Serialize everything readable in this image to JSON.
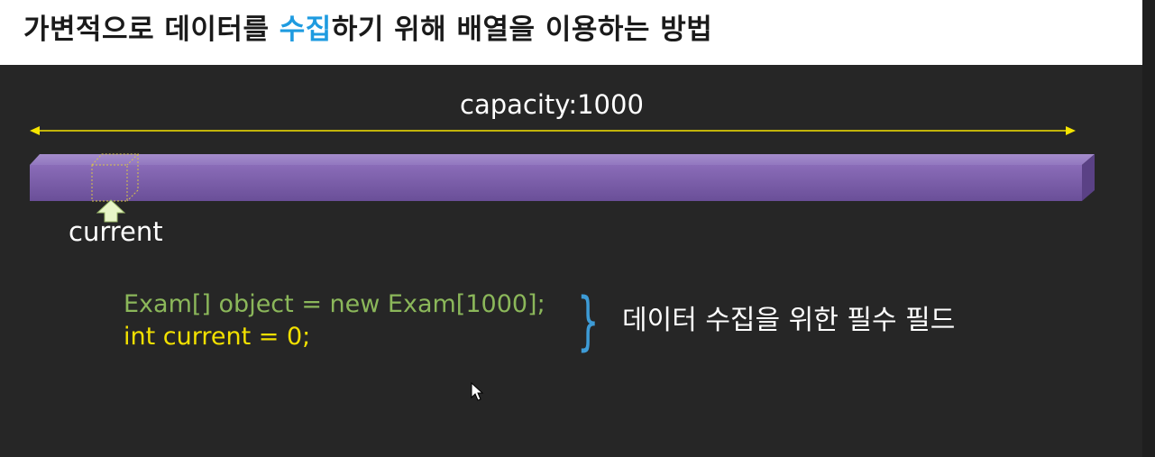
{
  "title": {
    "before": "가변적으로 데이터를 ",
    "highlight": "수집",
    "after": "하기 위해 배열을 이용하는 방법"
  },
  "diagram": {
    "capacity_label": "capacity:1000",
    "current_label": "current",
    "colors": {
      "array_bar": "#7b5ea7",
      "arrow_line": "#f5e400",
      "pointer_arrow": "#e8f5c8",
      "slot_outline": "#d8c44a"
    }
  },
  "code": {
    "line1": "Exam[] object = new Exam[1000];",
    "line2": "int current = 0;"
  },
  "annotation": {
    "brace": "}",
    "label": "데이터 수집을 위한 필수 필드"
  }
}
